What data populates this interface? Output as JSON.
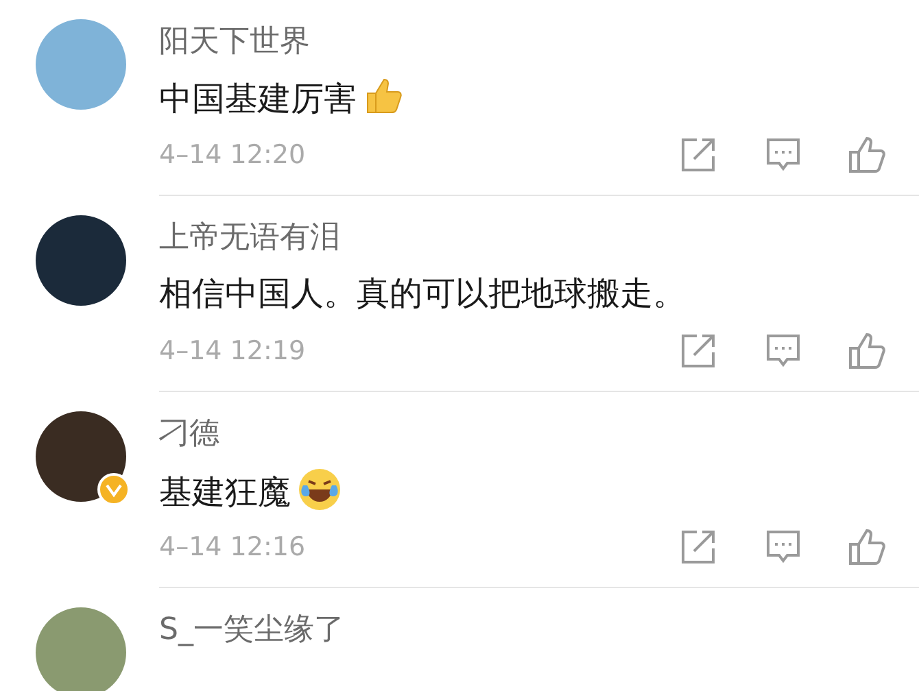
{
  "comments": [
    {
      "kind": "thumbsup",
      "user": "阳天下世界",
      "text": "中国基建厉害",
      "verified": false,
      "time": "4–14 12:20"
    },
    {
      "kind": "plain",
      "user": "上帝无语有泪",
      "text": "相信中国人。真的可以把地球搬走。",
      "verified": false,
      "time": "4–14 12:19"
    },
    {
      "kind": "laughing",
      "user": "刁德",
      "text": "基建狂魔",
      "verified": true,
      "time": "4–14 12:16"
    },
    {
      "kind": "cut",
      "user": "S_一笑尘缘了",
      "verified": false
    }
  ]
}
